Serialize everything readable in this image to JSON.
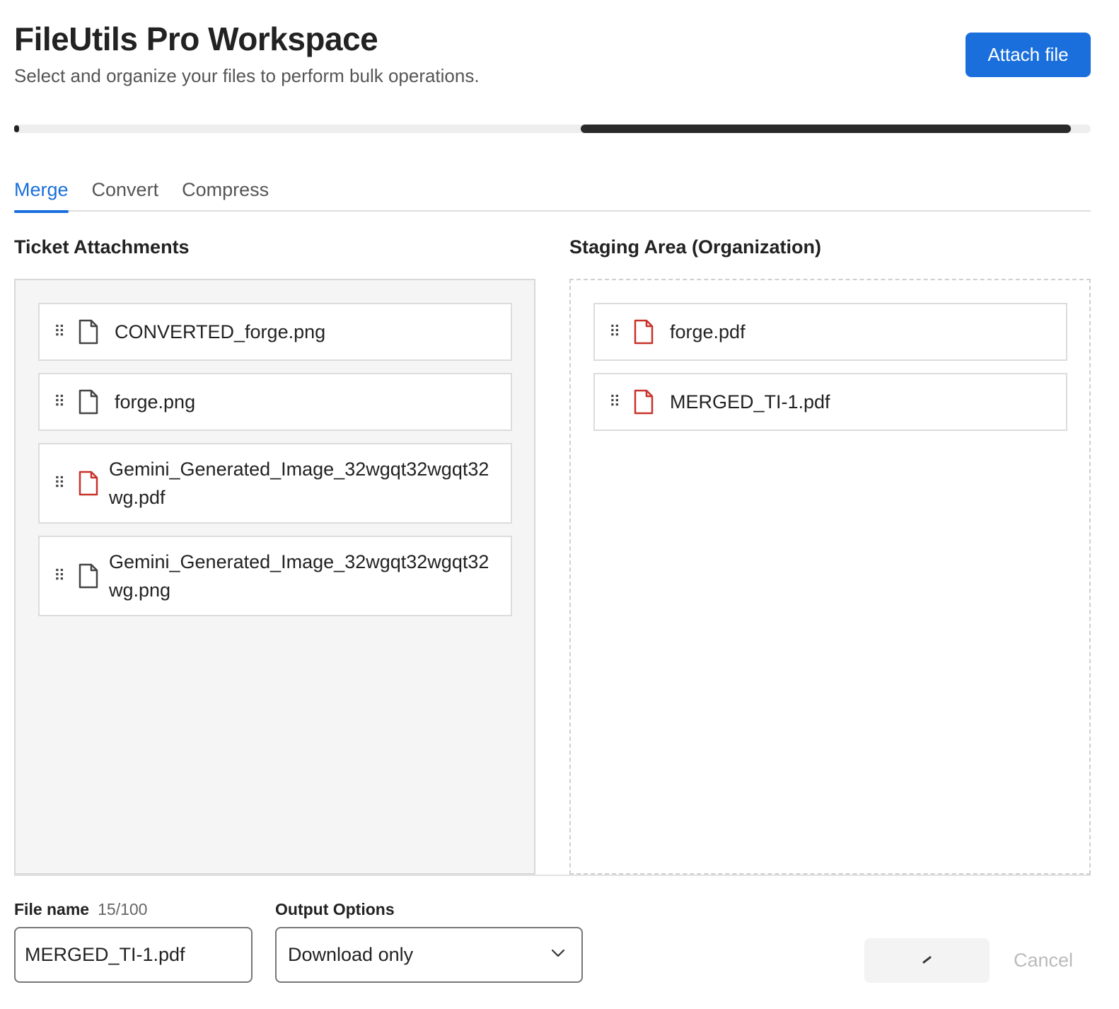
{
  "header": {
    "title": "FileUtils Pro Workspace",
    "subtitle": "Select and organize your files to perform bulk operations.",
    "attach_label": "Attach file"
  },
  "progress": {
    "segment_start": 0.526,
    "segment_end": 0.982
  },
  "tabs": [
    {
      "label": "Merge",
      "active": true
    },
    {
      "label": "Convert",
      "active": false
    },
    {
      "label": "Compress",
      "active": false
    }
  ],
  "left_panel": {
    "title": "Ticket Attachments",
    "files": [
      {
        "name": "CONVERTED_forge.png",
        "icon": "file-icon"
      },
      {
        "name": "forge.png",
        "icon": "file-icon"
      },
      {
        "name": "Gemini_Generated_Image_32wgqt32wgqt32wg.pdf",
        "icon": "pdf-file-icon"
      },
      {
        "name": "Gemini_Generated_Image_32wgqt32wgqt32wg.png",
        "icon": "file-icon"
      }
    ]
  },
  "right_panel": {
    "title": "Staging Area (Organization)",
    "files": [
      {
        "name": "forge.pdf",
        "icon": "pdf-file-icon"
      },
      {
        "name": "MERGED_TI-1.pdf",
        "icon": "pdf-file-icon"
      }
    ]
  },
  "form": {
    "file_name_label": "File name",
    "file_name_count": "15/100",
    "file_name_value": "MERGED_TI-1.pdf",
    "output_label": "Output Options",
    "output_value": "Download only",
    "cancel_label": "Cancel"
  },
  "colors": {
    "accent": "#1a6fdc",
    "pdf": "#c8322a",
    "text": "#222222"
  }
}
